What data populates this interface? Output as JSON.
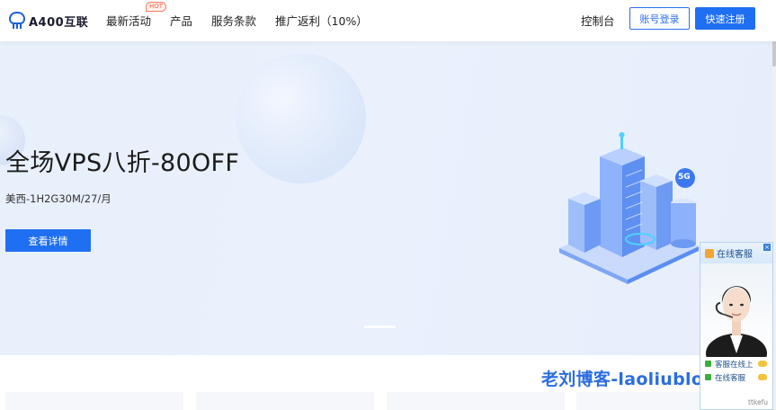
{
  "header": {
    "logo_text": "A400互联",
    "nav": [
      {
        "label": "最新活动",
        "badge": "HOT"
      },
      {
        "label": "产品"
      },
      {
        "label": "服务条款"
      },
      {
        "label": "推广返利（10%）"
      }
    ],
    "console_label": "控制台",
    "login_label": "账号登录",
    "register_label": "快速注册"
  },
  "hero": {
    "title": "全场VPS八折-80OFF",
    "subtitle": "美西-1H2G30M/27/月",
    "button_label": "查看详情",
    "illustration_badge": "5G"
  },
  "watermark": "老刘博客-laoliublog.cn",
  "chat": {
    "title": "在线客服",
    "close": "×",
    "row1": "客服在线上",
    "row2": "在线客服",
    "footer": "ttkefu"
  },
  "colors": {
    "primary": "#1f6ff2",
    "hot": "#ff5a3c",
    "hero_bg": "#e8f0fc"
  }
}
